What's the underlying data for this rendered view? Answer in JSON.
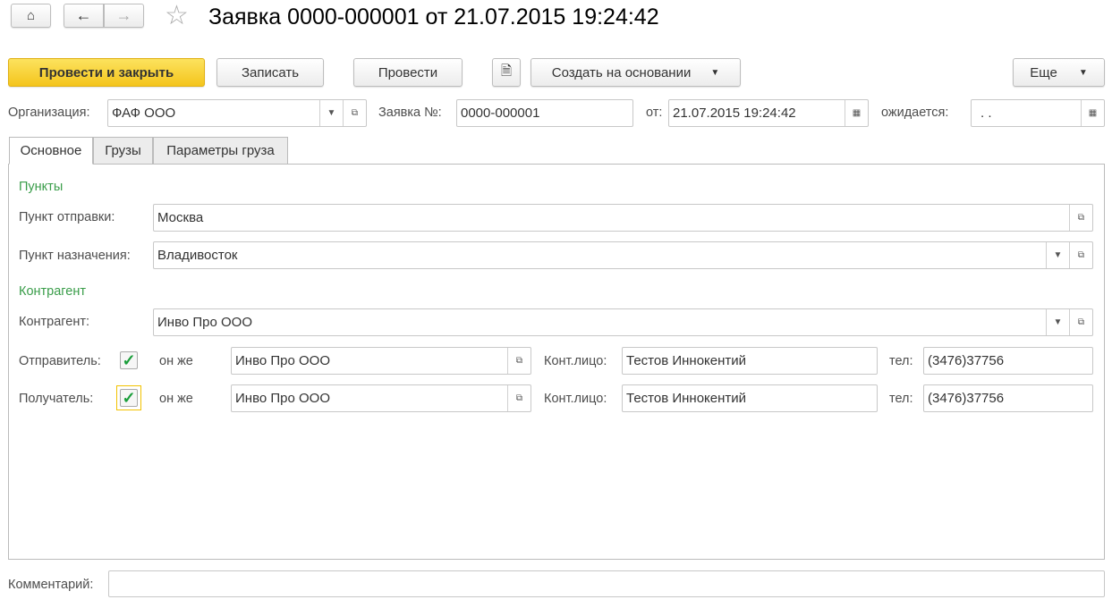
{
  "header": {
    "title": "Заявка 0000-000001 от 21.07.2015 19:24:42"
  },
  "toolbar": {
    "post_close": "Провести и закрыть",
    "save": "Записать",
    "post": "Провести",
    "create_based": "Создать на основании",
    "more": "Еще"
  },
  "top": {
    "org_label": "Организация:",
    "org_value": "ФАФ ООО",
    "num_label": "Заявка №:",
    "num_value": "0000-000001",
    "date_label": "от:",
    "date_value": "21.07.2015 19:24:42",
    "expected_label": "ожидается:",
    "expected_value": " .  ."
  },
  "tabs": [
    "Основное",
    "Грузы",
    "Параметры груза"
  ],
  "points": {
    "group": "Пункты",
    "from_label": "Пункт отправки:",
    "from_value": "Москва",
    "to_label": "Пункт назначения:",
    "to_value": "Владивосток"
  },
  "contractor": {
    "group": "Контрагент",
    "label": "Контрагент:",
    "value": "Инво Про ООО"
  },
  "sender": {
    "label": "Отправитель:",
    "checked": true,
    "same": "он же",
    "value": "Инво Про ООО",
    "contact_label": "Конт.лицо:",
    "contact": "Тестов Иннокентий",
    "phone_label": "тел:",
    "phone": "(3476)37756"
  },
  "receiver": {
    "label": "Получатель:",
    "checked": true,
    "same": "он же",
    "value": "Инво Про ООО",
    "contact_label": "Конт.лицо:",
    "contact": "Тестов Иннокентий",
    "phone_label": "тел:",
    "phone": "(3476)37756"
  },
  "comment": {
    "label": "Комментарий:",
    "value": ""
  }
}
